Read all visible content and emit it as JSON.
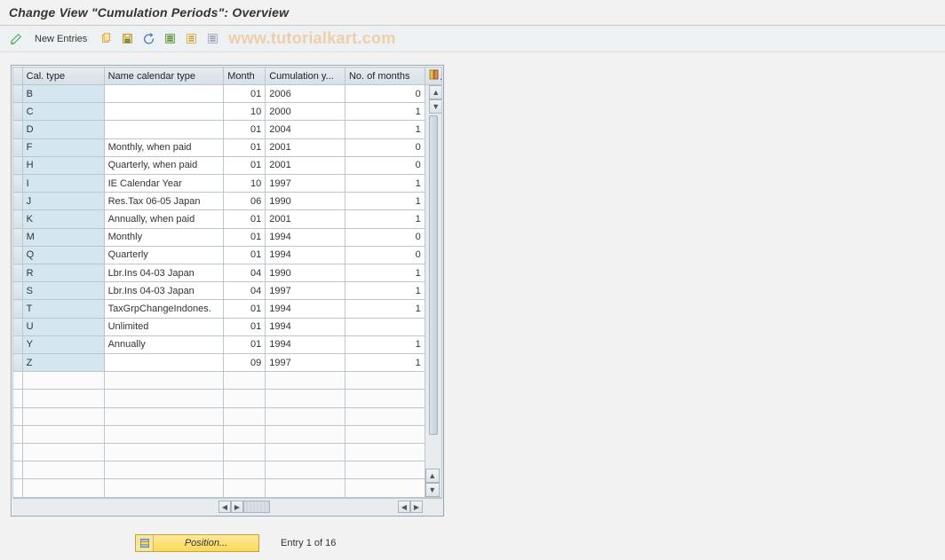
{
  "title": "Change View \"Cumulation Periods\": Overview",
  "toolbar": {
    "new_entries": "New Entries"
  },
  "watermark": "www.tutorialkart.com",
  "columns": {
    "cal_type": "Cal. type",
    "name_cal_type": "Name calendar type",
    "month": "Month",
    "cum_year": "Cumulation y...",
    "no_months": "No. of months"
  },
  "rows": [
    {
      "ct": "B",
      "name": "",
      "mo": "01",
      "yr": "2006",
      "nm": "0"
    },
    {
      "ct": "C",
      "name": "",
      "mo": "10",
      "yr": "2000",
      "nm": "1"
    },
    {
      "ct": "D",
      "name": "",
      "mo": "01",
      "yr": "2004",
      "nm": "1"
    },
    {
      "ct": "F",
      "name": "Monthly, when paid",
      "mo": "01",
      "yr": "2001",
      "nm": "0"
    },
    {
      "ct": "H",
      "name": "Quarterly, when paid",
      "mo": "01",
      "yr": "2001",
      "nm": "0"
    },
    {
      "ct": "I",
      "name": "IE Calendar Year",
      "mo": "10",
      "yr": "1997",
      "nm": "1"
    },
    {
      "ct": "J",
      "name": "Res.Tax 06-05  Japan",
      "mo": "06",
      "yr": "1990",
      "nm": "1"
    },
    {
      "ct": "K",
      "name": "Annually, when paid",
      "mo": "01",
      "yr": "2001",
      "nm": "1"
    },
    {
      "ct": "M",
      "name": "Monthly",
      "mo": "01",
      "yr": "1994",
      "nm": "0"
    },
    {
      "ct": "Q",
      "name": "Quarterly",
      "mo": "01",
      "yr": "1994",
      "nm": "0"
    },
    {
      "ct": "R",
      "name": "Lbr.Ins 04-03  Japan",
      "mo": "04",
      "yr": "1990",
      "nm": "1"
    },
    {
      "ct": "S",
      "name": "Lbr.Ins 04-03  Japan",
      "mo": "04",
      "yr": "1997",
      "nm": "1"
    },
    {
      "ct": "T",
      "name": "TaxGrpChangeIndones.",
      "mo": "01",
      "yr": "1994",
      "nm": "1"
    },
    {
      "ct": "U",
      "name": "Unlimited",
      "mo": "01",
      "yr": "1994",
      "nm": ""
    },
    {
      "ct": "Y",
      "name": "Annually",
      "mo": "01",
      "yr": "1994",
      "nm": "1"
    },
    {
      "ct": "Z",
      "name": "",
      "mo": "09",
      "yr": "1997",
      "nm": "1"
    }
  ],
  "empty_rows": 7,
  "footer": {
    "position_label": "Position...",
    "entry_text": "Entry 1 of 16"
  }
}
